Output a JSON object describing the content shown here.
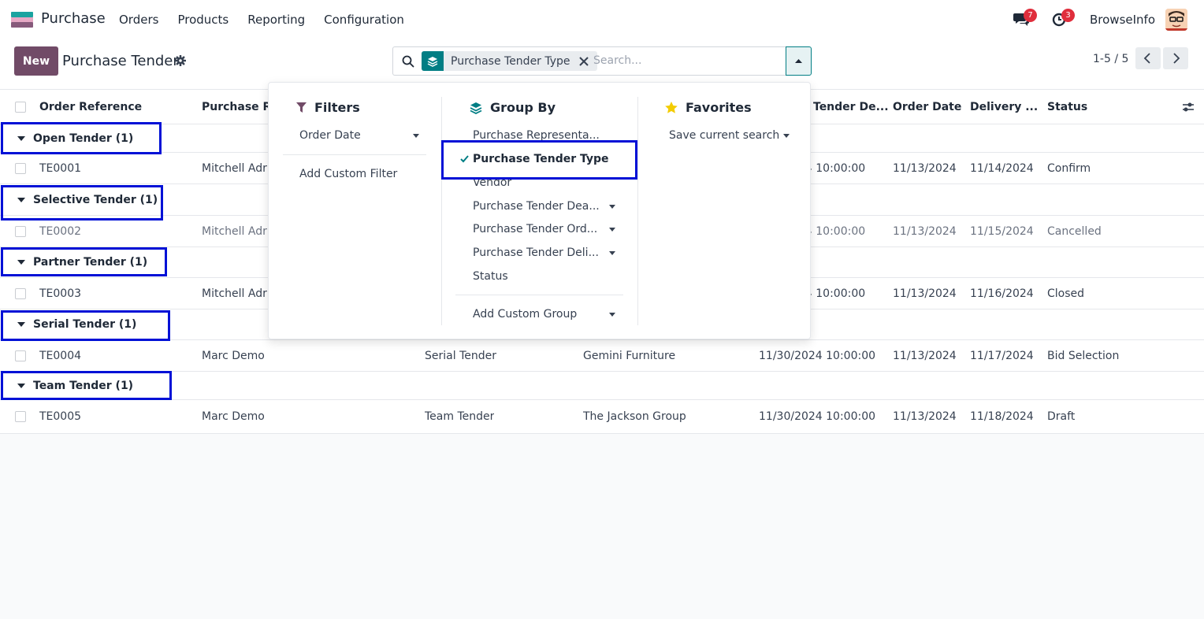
{
  "navbar": {
    "app_name": "Purchase",
    "menu": [
      "Orders",
      "Products",
      "Reporting",
      "Configuration"
    ],
    "chat_badge": "7",
    "activity_badge": "3",
    "company": "BrowseInfo"
  },
  "control_panel": {
    "new_label": "New",
    "title": "Purchase Tender",
    "facet_label": "Purchase Tender Type",
    "search_placeholder": "Search...",
    "pager": "1-5 / 5"
  },
  "table": {
    "columns": [
      "Order Reference",
      "Purchase Re",
      "Tender De...",
      "Order Date",
      "Delivery ...",
      "Status"
    ],
    "groups": [
      {
        "label": "Open Tender (1)",
        "row": {
          "ref": "TE0001",
          "rep": "Mitchell Adr",
          "type": "",
          "vendor": "",
          "deadline": "24 10:00:00",
          "order_date": "11/13/2024",
          "delivery": "11/14/2024",
          "status": "Confirm"
        }
      },
      {
        "label": "Selective Tender (1)",
        "row": {
          "ref": "TE0002",
          "rep": "Mitchell Adr",
          "type": "",
          "vendor": "",
          "deadline": "24 10:00:00",
          "order_date": "11/13/2024",
          "delivery": "11/15/2024",
          "status": "Cancelled"
        }
      },
      {
        "label": "Partner Tender (1)",
        "row": {
          "ref": "TE0003",
          "rep": "Mitchell Adr",
          "type": "",
          "vendor": "",
          "deadline": "24 10:00:00",
          "order_date": "11/13/2024",
          "delivery": "11/16/2024",
          "status": "Closed"
        }
      },
      {
        "label": "Serial Tender (1)",
        "row": {
          "ref": "TE0004",
          "rep": "Marc Demo",
          "type": "Serial Tender",
          "vendor": "Gemini Furniture",
          "deadline": "11/30/2024 10:00:00",
          "order_date": "11/13/2024",
          "delivery": "11/17/2024",
          "status": "Bid Selection"
        }
      },
      {
        "label": "Team Tender (1)",
        "row": {
          "ref": "TE0005",
          "rep": "Marc Demo",
          "type": "Team Tender",
          "vendor": "The Jackson Group",
          "deadline": "11/30/2024 10:00:00",
          "order_date": "11/13/2024",
          "delivery": "11/18/2024",
          "status": "Draft"
        }
      }
    ]
  },
  "dropdown": {
    "filters": {
      "title": "Filters",
      "order_date": "Order Date",
      "add_custom": "Add Custom Filter"
    },
    "group_by": {
      "title": "Group By",
      "items": [
        "Purchase Representa...",
        "Purchase Tender Type",
        "Vendor",
        "Purchase Tender Dea...",
        "Purchase Tender Ord...",
        "Purchase Tender Deli...",
        "Status"
      ],
      "add_custom": "Add Custom Group"
    },
    "favorites": {
      "title": "Favorites",
      "save_search": "Save current search"
    }
  },
  "colors": {
    "brand": "#714b67",
    "accent": "#017e84",
    "highlight": "#0011d6",
    "badge": "#e02e3c"
  }
}
